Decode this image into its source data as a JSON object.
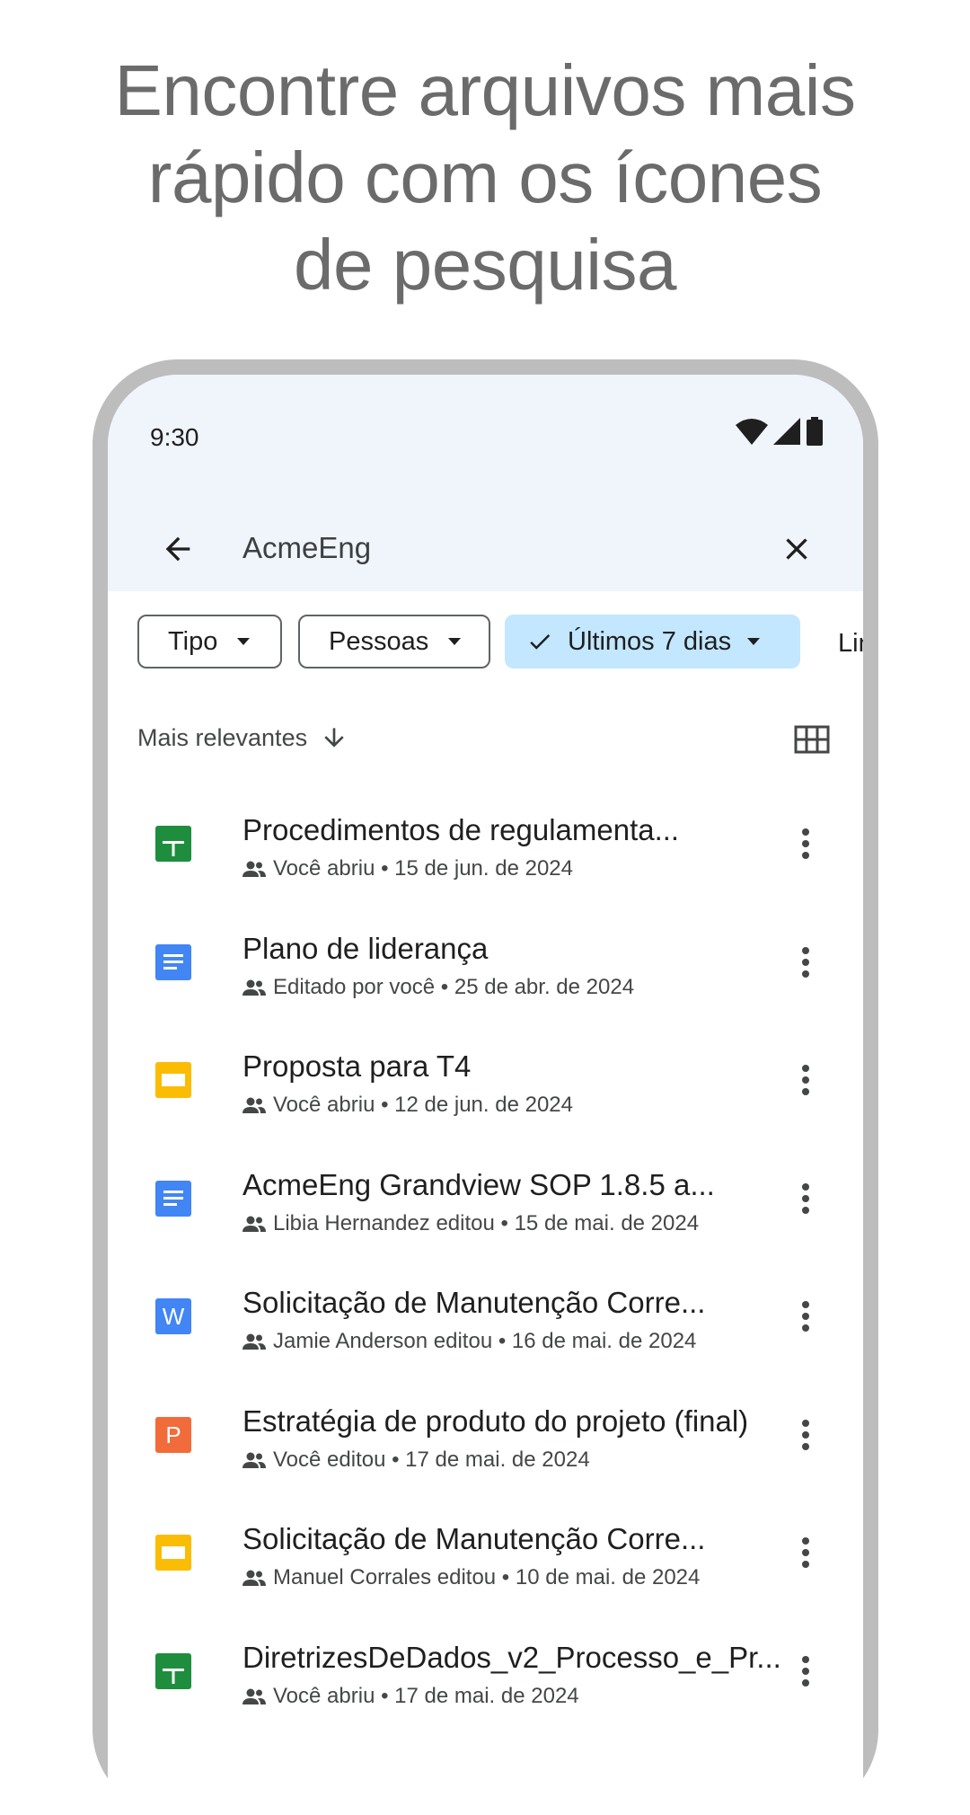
{
  "headline": {
    "line1": "Encontre arquivos mais",
    "line2": "rápido com os ícones",
    "line3": "de pesquisa"
  },
  "status_bar": {
    "time": "9:30",
    "icons": [
      "wifi-icon",
      "signal-icon",
      "battery-icon"
    ]
  },
  "search": {
    "query": "AcmeEng"
  },
  "chips": [
    {
      "label": "Tipo"
    },
    {
      "label": "Pessoas"
    },
    {
      "label": "Últimos 7 dias",
      "selected": true
    },
    {
      "label": "Lin"
    }
  ],
  "sort": {
    "label": "Mais relevantes"
  },
  "colors": {
    "sheets": "#1e8e3e",
    "docs": "#4285f4",
    "slides": "#fbbc04",
    "word": "#4285f4",
    "powerpoint": "#f26b3a",
    "chip_selected": "#c2e7ff",
    "topbar": "#f0f4fb"
  },
  "files": [
    {
      "title": "Procedimentos de regulamenta...",
      "meta": "Você abriu • 15 de jun. de 2024",
      "icon": "sheets-icon"
    },
    {
      "title": "Plano de liderança",
      "meta": "Editado por você • 25 de abr. de 2024",
      "icon": "docs-icon"
    },
    {
      "title": "Proposta para T4",
      "meta": "Você abriu • 12 de jun. de 2024",
      "icon": "slides-icon"
    },
    {
      "title": "AcmeEng Grandview SOP 1.8.5 a...",
      "meta": "Libia Hernandez editou • 15 de mai. de 2024",
      "icon": "docs-icon"
    },
    {
      "title": "Solicitação de Manutenção Corre...",
      "meta": "Jamie Anderson editou • 16 de mai. de 2024",
      "icon": "word-icon",
      "badge": "W"
    },
    {
      "title": "Estratégia de produto do projeto (final)",
      "meta": "Você editou • 17 de mai. de 2024",
      "icon": "powerpoint-icon",
      "badge": "P"
    },
    {
      "title": "Solicitação de Manutenção Corre...",
      "meta": "Manuel Corrales editou • 10 de mai. de 2024",
      "icon": "slides-icon"
    },
    {
      "title": "DiretrizesDeDados_v2_Processo_e_Pr...",
      "meta": "Você abriu • 17 de mai. de 2024",
      "icon": "sheets-icon"
    }
  ]
}
